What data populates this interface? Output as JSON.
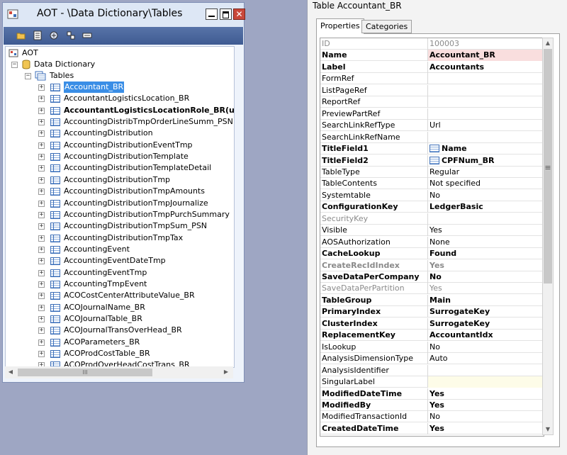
{
  "aot": {
    "title": "AOT - \\Data Dictionary\\Tables",
    "close_glyph": "✕",
    "root": "AOT",
    "data_dictionary": "Data Dictionary",
    "tables_node": "Tables",
    "tables": [
      {
        "name": "Accountant_BR",
        "selected": true,
        "bold": false
      },
      {
        "name": "AccountantLogisticsLocation_BR",
        "selected": false,
        "bold": false
      },
      {
        "name": "AccountantLogisticsLocationRole_BR(usr)",
        "selected": false,
        "bold": true
      },
      {
        "name": "AccountingDistribTmpOrderLineSumm_PSN",
        "selected": false,
        "bold": false
      },
      {
        "name": "AccountingDistribution",
        "selected": false,
        "bold": false
      },
      {
        "name": "AccountingDistributionEventTmp",
        "selected": false,
        "bold": false
      },
      {
        "name": "AccountingDistributionTemplate",
        "selected": false,
        "bold": false
      },
      {
        "name": "AccountingDistributionTemplateDetail",
        "selected": false,
        "bold": false
      },
      {
        "name": "AccountingDistributionTmp",
        "selected": false,
        "bold": false
      },
      {
        "name": "AccountingDistributionTmpAmounts",
        "selected": false,
        "bold": false
      },
      {
        "name": "AccountingDistributionTmpJournalize",
        "selected": false,
        "bold": false
      },
      {
        "name": "AccountingDistributionTmpPurchSummary",
        "selected": false,
        "bold": false
      },
      {
        "name": "AccountingDistributionTmpSum_PSN",
        "selected": false,
        "bold": false
      },
      {
        "name": "AccountingDistributionTmpTax",
        "selected": false,
        "bold": false
      },
      {
        "name": "AccountingEvent",
        "selected": false,
        "bold": false
      },
      {
        "name": "AccountingEventDateTmp",
        "selected": false,
        "bold": false
      },
      {
        "name": "AccountingEventTmp",
        "selected": false,
        "bold": false
      },
      {
        "name": "AccountingTmpEvent",
        "selected": false,
        "bold": false
      },
      {
        "name": "ACOCostCenterAttributeValue_BR",
        "selected": false,
        "bold": false
      },
      {
        "name": "ACOJournalName_BR",
        "selected": false,
        "bold": false
      },
      {
        "name": "ACOJournalTable_BR",
        "selected": false,
        "bold": false
      },
      {
        "name": "ACOJournalTransOverHead_BR",
        "selected": false,
        "bold": false
      },
      {
        "name": "ACOParameters_BR",
        "selected": false,
        "bold": false
      },
      {
        "name": "ACOProdCostTable_BR",
        "selected": false,
        "bold": false
      },
      {
        "name": "ACOProdOverHeadCostTrans_BR",
        "selected": false,
        "bold": false
      }
    ],
    "hscroll_thumb_glyph": "III"
  },
  "props": {
    "title": "Table Accountant_BR",
    "tabs": [
      "Properties",
      "Categories"
    ],
    "grip_glyph": "≡",
    "rows": [
      {
        "name": "ID",
        "value": "100003",
        "style": "grey"
      },
      {
        "name": "Name",
        "value": "Accountant_BR",
        "style": "bold-pink"
      },
      {
        "name": "Label",
        "value": "Accountants",
        "style": "bold"
      },
      {
        "name": "FormRef",
        "value": "",
        "style": ""
      },
      {
        "name": "ListPageRef",
        "value": "",
        "style": ""
      },
      {
        "name": "ReportRef",
        "value": "",
        "style": ""
      },
      {
        "name": "PreviewPartRef",
        "value": "",
        "style": ""
      },
      {
        "name": "SearchLinkRefType",
        "value": "Url",
        "style": ""
      },
      {
        "name": "SearchLinkRefName",
        "value": "",
        "style": ""
      },
      {
        "name": "TitleField1",
        "value": "Name",
        "style": "bold",
        "icon": "field-icon"
      },
      {
        "name": "TitleField2",
        "value": "CPFNum_BR",
        "style": "bold",
        "icon": "field-icon"
      },
      {
        "name": "TableType",
        "value": "Regular",
        "style": ""
      },
      {
        "name": "TableContents",
        "value": "Not specified",
        "style": ""
      },
      {
        "name": "Systemtable",
        "value": "No",
        "style": ""
      },
      {
        "name": "ConfigurationKey",
        "value": "LedgerBasic",
        "style": "bold"
      },
      {
        "name": "SecurityKey",
        "value": "",
        "style": "grey"
      },
      {
        "name": "Visible",
        "value": "Yes",
        "style": ""
      },
      {
        "name": "AOSAuthorization",
        "value": "None",
        "style": ""
      },
      {
        "name": "CacheLookup",
        "value": "Found",
        "style": "bold"
      },
      {
        "name": "CreateRecIdIndex",
        "value": "Yes",
        "style": "grey-bold"
      },
      {
        "name": "SaveDataPerCompany",
        "value": "No",
        "style": "bold"
      },
      {
        "name": "SaveDataPerPartition",
        "value": "Yes",
        "style": "grey"
      },
      {
        "name": "TableGroup",
        "value": "Main",
        "style": "bold"
      },
      {
        "name": "PrimaryIndex",
        "value": "SurrogateKey",
        "style": "bold"
      },
      {
        "name": "ClusterIndex",
        "value": "SurrogateKey",
        "style": "bold"
      },
      {
        "name": "ReplacementKey",
        "value": "AccountantIdx",
        "style": "bold"
      },
      {
        "name": "IsLookup",
        "value": "No",
        "style": ""
      },
      {
        "name": "AnalysisDimensionType",
        "value": "Auto",
        "style": ""
      },
      {
        "name": "AnalysisIdentifier",
        "value": "",
        "style": ""
      },
      {
        "name": "SingularLabel",
        "value": "",
        "style": "yellow"
      },
      {
        "name": "ModifiedDateTime",
        "value": "Yes",
        "style": "bold"
      },
      {
        "name": "ModifiedBy",
        "value": "Yes",
        "style": "bold"
      },
      {
        "name": "ModifiedTransactionId",
        "value": "No",
        "style": ""
      },
      {
        "name": "CreatedDateTime",
        "value": "Yes",
        "style": "bold"
      }
    ]
  },
  "colors": {
    "selection": "#3a8ee6",
    "toolbar": "#4a66a0",
    "close_button": "#c9483a",
    "name_value_highlight": "#f9dede",
    "desktop": "#9ea6c3"
  }
}
